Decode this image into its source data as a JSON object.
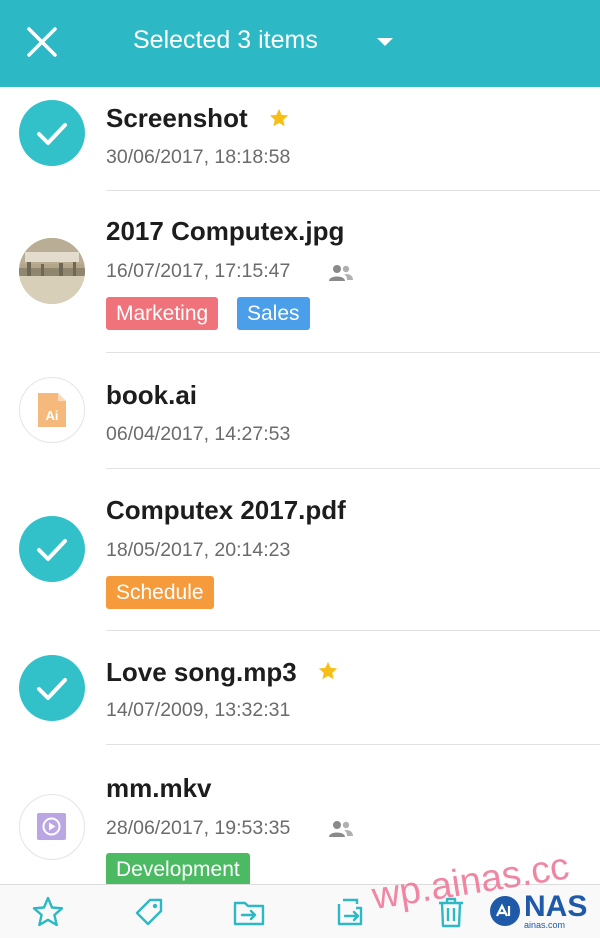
{
  "header": {
    "title": "Selected 3 items",
    "background": "#2cb8c4",
    "close_icon": "close-icon",
    "dropdown_icon": "caret-down-icon"
  },
  "files": [
    {
      "name": "Screenshot",
      "date": "30/06/2017, 18:18:58",
      "selected": true,
      "starred": true,
      "shared": false,
      "tags": []
    },
    {
      "name": "2017 Computex.jpg",
      "date": "16/07/2017, 17:15:47",
      "selected": false,
      "starred": false,
      "shared": true,
      "thumbnail": "photo-thumbnail",
      "tags": [
        {
          "label": "Marketing",
          "color": "#f0727a"
        },
        {
          "label": "Sales",
          "color": "#4a9eea"
        }
      ]
    },
    {
      "name": "book.ai",
      "date": "06/04/2017, 14:27:53",
      "selected": false,
      "starred": false,
      "shared": false,
      "file_icon": "ai-file-icon",
      "file_icon_label": "Ai",
      "tags": []
    },
    {
      "name": "Computex 2017.pdf",
      "date": "18/05/2017, 20:14:23",
      "selected": true,
      "starred": false,
      "shared": false,
      "tags": [
        {
          "label": "Schedule",
          "color": "#f59b3b"
        }
      ]
    },
    {
      "name": "Love song.mp3",
      "date": "14/07/2009, 13:32:31",
      "selected": true,
      "starred": true,
      "shared": false,
      "tags": []
    },
    {
      "name": "mm.mkv",
      "date": "28/06/2017, 19:53:35",
      "selected": false,
      "starred": false,
      "shared": true,
      "file_icon": "video-file-icon",
      "tags": [
        {
          "label": "Development",
          "color": "#4cb963"
        }
      ]
    }
  ],
  "toolbar": {
    "buttons": [
      "star-icon",
      "tag-icon",
      "move-to-folder-icon",
      "copy-icon",
      "trash-icon"
    ],
    "accent": "#2cb8c4"
  },
  "watermark": {
    "text": "wp.ainas.cc",
    "logo_text": "NAS",
    "logo_sub": "ainas.com"
  },
  "colors": {
    "selected_check": "#33c1c9",
    "star": "#f7bf16",
    "text_primary": "#1d1d1d",
    "text_secondary": "#6b6b6b"
  }
}
